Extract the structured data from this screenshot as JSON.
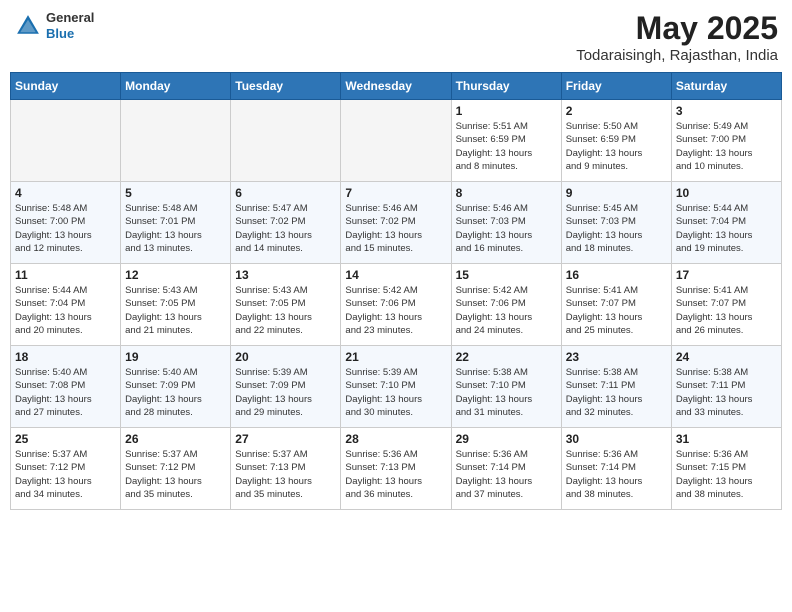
{
  "header": {
    "logo": {
      "general": "General",
      "blue": "Blue"
    },
    "title": "May 2025",
    "subtitle": "Todaraisingh, Rajasthan, India"
  },
  "weekdays": [
    "Sunday",
    "Monday",
    "Tuesday",
    "Wednesday",
    "Thursday",
    "Friday",
    "Saturday"
  ],
  "weeks": [
    [
      {
        "day": "",
        "info": ""
      },
      {
        "day": "",
        "info": ""
      },
      {
        "day": "",
        "info": ""
      },
      {
        "day": "",
        "info": ""
      },
      {
        "day": "1",
        "info": "Sunrise: 5:51 AM\nSunset: 6:59 PM\nDaylight: 13 hours\nand 8 minutes."
      },
      {
        "day": "2",
        "info": "Sunrise: 5:50 AM\nSunset: 6:59 PM\nDaylight: 13 hours\nand 9 minutes."
      },
      {
        "day": "3",
        "info": "Sunrise: 5:49 AM\nSunset: 7:00 PM\nDaylight: 13 hours\nand 10 minutes."
      }
    ],
    [
      {
        "day": "4",
        "info": "Sunrise: 5:48 AM\nSunset: 7:00 PM\nDaylight: 13 hours\nand 12 minutes."
      },
      {
        "day": "5",
        "info": "Sunrise: 5:48 AM\nSunset: 7:01 PM\nDaylight: 13 hours\nand 13 minutes."
      },
      {
        "day": "6",
        "info": "Sunrise: 5:47 AM\nSunset: 7:02 PM\nDaylight: 13 hours\nand 14 minutes."
      },
      {
        "day": "7",
        "info": "Sunrise: 5:46 AM\nSunset: 7:02 PM\nDaylight: 13 hours\nand 15 minutes."
      },
      {
        "day": "8",
        "info": "Sunrise: 5:46 AM\nSunset: 7:03 PM\nDaylight: 13 hours\nand 16 minutes."
      },
      {
        "day": "9",
        "info": "Sunrise: 5:45 AM\nSunset: 7:03 PM\nDaylight: 13 hours\nand 18 minutes."
      },
      {
        "day": "10",
        "info": "Sunrise: 5:44 AM\nSunset: 7:04 PM\nDaylight: 13 hours\nand 19 minutes."
      }
    ],
    [
      {
        "day": "11",
        "info": "Sunrise: 5:44 AM\nSunset: 7:04 PM\nDaylight: 13 hours\nand 20 minutes."
      },
      {
        "day": "12",
        "info": "Sunrise: 5:43 AM\nSunset: 7:05 PM\nDaylight: 13 hours\nand 21 minutes."
      },
      {
        "day": "13",
        "info": "Sunrise: 5:43 AM\nSunset: 7:05 PM\nDaylight: 13 hours\nand 22 minutes."
      },
      {
        "day": "14",
        "info": "Sunrise: 5:42 AM\nSunset: 7:06 PM\nDaylight: 13 hours\nand 23 minutes."
      },
      {
        "day": "15",
        "info": "Sunrise: 5:42 AM\nSunset: 7:06 PM\nDaylight: 13 hours\nand 24 minutes."
      },
      {
        "day": "16",
        "info": "Sunrise: 5:41 AM\nSunset: 7:07 PM\nDaylight: 13 hours\nand 25 minutes."
      },
      {
        "day": "17",
        "info": "Sunrise: 5:41 AM\nSunset: 7:07 PM\nDaylight: 13 hours\nand 26 minutes."
      }
    ],
    [
      {
        "day": "18",
        "info": "Sunrise: 5:40 AM\nSunset: 7:08 PM\nDaylight: 13 hours\nand 27 minutes."
      },
      {
        "day": "19",
        "info": "Sunrise: 5:40 AM\nSunset: 7:09 PM\nDaylight: 13 hours\nand 28 minutes."
      },
      {
        "day": "20",
        "info": "Sunrise: 5:39 AM\nSunset: 7:09 PM\nDaylight: 13 hours\nand 29 minutes."
      },
      {
        "day": "21",
        "info": "Sunrise: 5:39 AM\nSunset: 7:10 PM\nDaylight: 13 hours\nand 30 minutes."
      },
      {
        "day": "22",
        "info": "Sunrise: 5:38 AM\nSunset: 7:10 PM\nDaylight: 13 hours\nand 31 minutes."
      },
      {
        "day": "23",
        "info": "Sunrise: 5:38 AM\nSunset: 7:11 PM\nDaylight: 13 hours\nand 32 minutes."
      },
      {
        "day": "24",
        "info": "Sunrise: 5:38 AM\nSunset: 7:11 PM\nDaylight: 13 hours\nand 33 minutes."
      }
    ],
    [
      {
        "day": "25",
        "info": "Sunrise: 5:37 AM\nSunset: 7:12 PM\nDaylight: 13 hours\nand 34 minutes."
      },
      {
        "day": "26",
        "info": "Sunrise: 5:37 AM\nSunset: 7:12 PM\nDaylight: 13 hours\nand 35 minutes."
      },
      {
        "day": "27",
        "info": "Sunrise: 5:37 AM\nSunset: 7:13 PM\nDaylight: 13 hours\nand 35 minutes."
      },
      {
        "day": "28",
        "info": "Sunrise: 5:36 AM\nSunset: 7:13 PM\nDaylight: 13 hours\nand 36 minutes."
      },
      {
        "day": "29",
        "info": "Sunrise: 5:36 AM\nSunset: 7:14 PM\nDaylight: 13 hours\nand 37 minutes."
      },
      {
        "day": "30",
        "info": "Sunrise: 5:36 AM\nSunset: 7:14 PM\nDaylight: 13 hours\nand 38 minutes."
      },
      {
        "day": "31",
        "info": "Sunrise: 5:36 AM\nSunset: 7:15 PM\nDaylight: 13 hours\nand 38 minutes."
      }
    ]
  ]
}
